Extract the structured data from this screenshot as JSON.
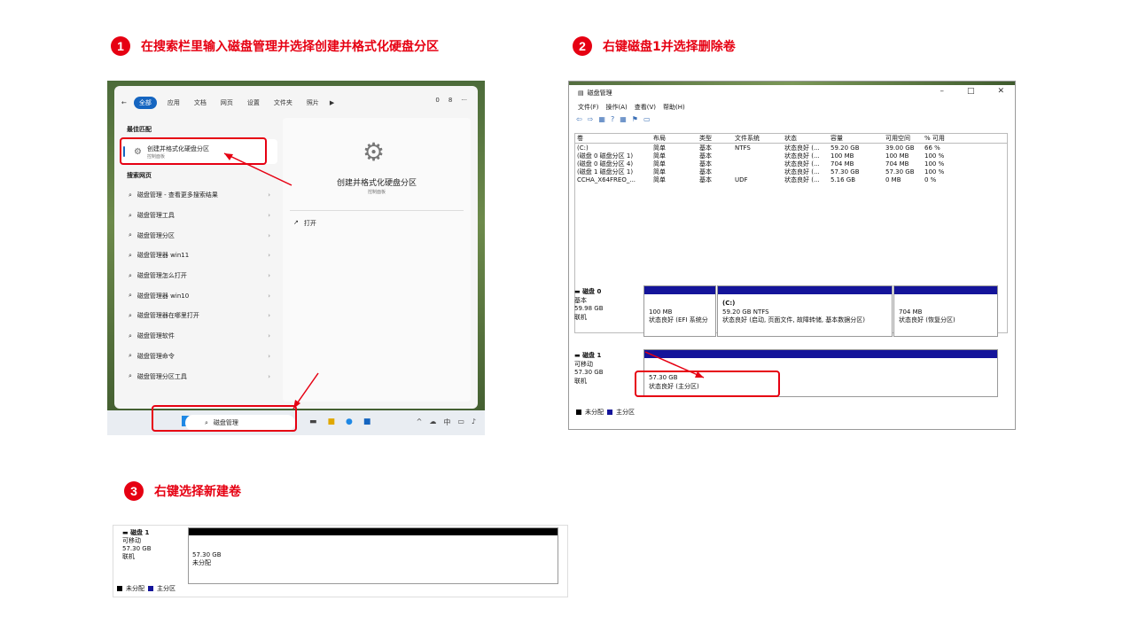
{
  "steps": [
    {
      "num": "1",
      "text": "在搜索栏里输入磁盘管理并选择创建并格式化硬盘分区"
    },
    {
      "num": "2",
      "text": "右键磁盘1并选择删除卷"
    },
    {
      "num": "3",
      "text": "右键选择新建卷"
    }
  ],
  "search_panel": {
    "tabs": [
      "全部",
      "应用",
      "文档",
      "网页",
      "设置",
      "文件夹",
      "照片"
    ],
    "tabs_right": [
      "0",
      "8",
      "···"
    ],
    "best_match_header": "最佳匹配",
    "best_match_title": "创建并格式化硬盘分区",
    "best_match_sub": "控制面板",
    "web_header": "搜索网页",
    "web_items": [
      "磁盘管理 - 查看更多搜索结果",
      "磁盘管理工具",
      "磁盘管理分区",
      "磁盘管理器 win11",
      "磁盘管理怎么打开",
      "磁盘管理器 win10",
      "磁盘管理器在哪里打开",
      "磁盘管理软件",
      "磁盘管理命令",
      "磁盘管理分区工具"
    ],
    "right_title": "创建并格式化硬盘分区",
    "right_sub": "控制面板",
    "open_label": "打开",
    "search_query": "磁盘管理"
  },
  "disk_mgmt": {
    "title": "磁盘管理",
    "menu": [
      "文件(F)",
      "操作(A)",
      "查看(V)",
      "帮助(H)"
    ],
    "columns": [
      "卷",
      "布局",
      "类型",
      "文件系统",
      "状态",
      "容量",
      "可用空间",
      "% 可用"
    ],
    "rows": [
      [
        "(C:)",
        "简单",
        "基本",
        "NTFS",
        "状态良好 (...",
        "59.20 GB",
        "39.00 GB",
        "66 %"
      ],
      [
        "(磁盘 0 磁盘分区 1)",
        "简单",
        "基本",
        "",
        "状态良好 (...",
        "100 MB",
        "100 MB",
        "100 %"
      ],
      [
        "(磁盘 0 磁盘分区 4)",
        "简单",
        "基本",
        "",
        "状态良好 (...",
        "704 MB",
        "704 MB",
        "100 %"
      ],
      [
        "(磁盘 1 磁盘分区 1)",
        "简单",
        "基本",
        "",
        "状态良好 (...",
        "57.30 GB",
        "57.30 GB",
        "100 %"
      ],
      [
        "CCHA_X64FREO_...",
        "简单",
        "基本",
        "UDF",
        "状态良好 (...",
        "5.16 GB",
        "0 MB",
        "0 %"
      ]
    ],
    "disk0": {
      "name": "磁盘 0",
      "type": "基本",
      "size": "59.98 GB",
      "status": "联机",
      "partitions": [
        {
          "line1": "",
          "line2": "100 MB",
          "line3": "状态良好 (EFI 系统分"
        },
        {
          "line1": "(C:)",
          "line2": "59.20 GB NTFS",
          "line3": "状态良好 (启动, 页面文件, 故障转储, 基本数据分区)"
        },
        {
          "line1": "",
          "line2": "704 MB",
          "line3": "状态良好 (恢复分区)"
        }
      ]
    },
    "disk1": {
      "name": "磁盘 1",
      "type": "可移动",
      "size": "57.30 GB",
      "status": "联机",
      "part_size": "57.30 GB",
      "part_status": "状态良好 (主分区)"
    },
    "legend": [
      "未分配",
      "主分区"
    ]
  },
  "step3_panel": {
    "name": "磁盘 1",
    "type": "可移动",
    "size": "57.30 GB",
    "status": "联机",
    "part_size": "57.30 GB",
    "part_status": "未分配",
    "legend": [
      "未分配",
      "主分区"
    ]
  },
  "colors": {
    "accent": "#e60012",
    "primary_partition": "#14149a",
    "unallocated": "#000000"
  }
}
